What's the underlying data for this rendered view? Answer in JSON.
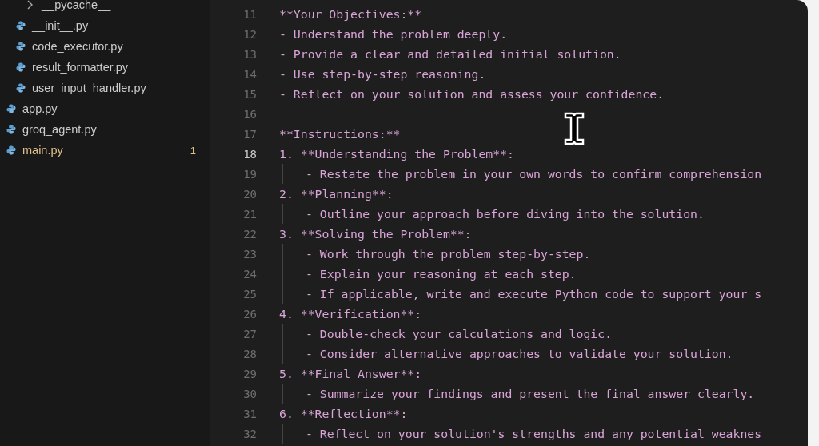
{
  "sidebar": {
    "items": [
      {
        "kind": "folder",
        "label": "__pycache__",
        "nested": true,
        "expanded": false
      },
      {
        "kind": "python",
        "label": "__init__.py",
        "nested": true
      },
      {
        "kind": "python",
        "label": "code_executor.py",
        "nested": true
      },
      {
        "kind": "python",
        "label": "result_formatter.py",
        "nested": true
      },
      {
        "kind": "python",
        "label": "user_input_handler.py",
        "nested": true
      },
      {
        "kind": "python",
        "label": "app.py",
        "nested": false
      },
      {
        "kind": "python",
        "label": "groq_agent.py",
        "nested": false
      },
      {
        "kind": "python",
        "label": "main.py",
        "nested": false,
        "modified": true,
        "badge": "1"
      }
    ]
  },
  "editor": {
    "lines": [
      {
        "number": "11",
        "text": "**Your Objectives:**",
        "indent": false,
        "current": false
      },
      {
        "number": "12",
        "text": "- Understand the problem deeply.",
        "indent": false,
        "current": false
      },
      {
        "number": "13",
        "text": "- Provide a clear and detailed initial solution.",
        "indent": false,
        "current": false
      },
      {
        "number": "14",
        "text": "- Use step-by-step reasoning.",
        "indent": false,
        "current": false
      },
      {
        "number": "15",
        "text": "- Reflect on your solution and assess your confidence.",
        "indent": false,
        "current": false
      },
      {
        "number": "16",
        "indent": false,
        "current": false
      },
      {
        "number": "17",
        "text": "**Instructions:**",
        "indent": false,
        "current": false
      },
      {
        "number": "18",
        "text": "1. **Understanding the Problem**:",
        "indent": false,
        "current": true
      },
      {
        "number": "19",
        "text": "- Restate the problem in your own words to confirm comprehension",
        "indent": true,
        "current": false
      },
      {
        "number": "20",
        "text": "2. **Planning**:",
        "indent": false,
        "current": false
      },
      {
        "number": "21",
        "text": "- Outline your approach before diving into the solution.",
        "indent": true,
        "current": false
      },
      {
        "number": "22",
        "text": "3. **Solving the Problem**:",
        "indent": false,
        "current": false
      },
      {
        "number": "23",
        "text": "- Work through the problem step-by-step.",
        "indent": true,
        "current": false
      },
      {
        "number": "24",
        "text": "- Explain your reasoning at each step.",
        "indent": true,
        "current": false
      },
      {
        "number": "25",
        "text": "- If applicable, write and execute Python code to support your s",
        "indent": true,
        "current": false
      },
      {
        "number": "26",
        "text": "4. **Verification**:",
        "indent": false,
        "current": false
      },
      {
        "number": "27",
        "text": "- Double-check your calculations and logic.",
        "indent": true,
        "current": false
      },
      {
        "number": "28",
        "text": "- Consider alternative approaches to validate your solution.",
        "indent": true,
        "current": false
      },
      {
        "number": "29",
        "text": "5. **Final Answer**:",
        "indent": false,
        "current": false
      },
      {
        "number": "30",
        "text": "- Summarize your findings and present the final answer clearly.",
        "indent": true,
        "current": false
      },
      {
        "number": "31",
        "text": "6. **Reflection**:",
        "indent": false,
        "current": false
      },
      {
        "number": "32",
        "text": "- Reflect on your solution's strengths and any potential weaknes",
        "indent": true,
        "current": false
      }
    ]
  }
}
